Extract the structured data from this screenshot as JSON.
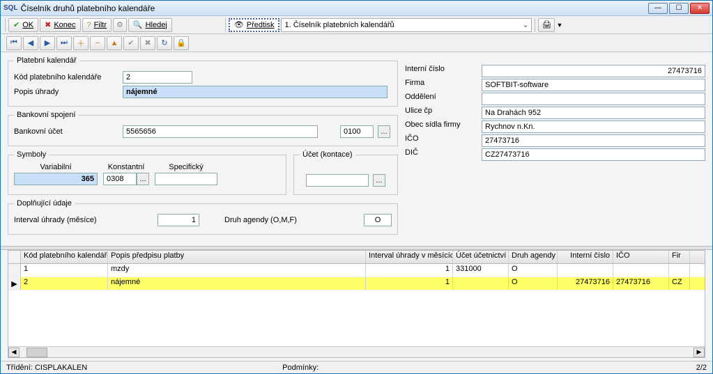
{
  "window": {
    "title": "Číselník druhů platebního kalendáře"
  },
  "toolbar": {
    "ok": "OK",
    "konec": "Konec",
    "filtr": "Filtr",
    "hledej": "Hledej",
    "predtisk": "Předtisk",
    "combo_value": "1. Číselník platebních kalendářů"
  },
  "form": {
    "platebni_kalendar_legend": "Platební kalendář",
    "kod_label": "Kód platebního kalendáře",
    "kod_value": "2",
    "popis_label": "Popis úhrady",
    "popis_value": "nájemné",
    "bankovni_spojeni_legend": "Bankovní spojení",
    "bankovni_ucet_label": "Bankovní účet",
    "bankovni_ucet_value": "5565656",
    "bank_code": "0100",
    "symboly_legend": "Symboly",
    "variabilni_label": "Variabilní",
    "variabilni_value": "365",
    "konstantni_label": "Konstantní",
    "konstantni_value": "0308",
    "specificky_label": "Specifický",
    "specificky_value": "",
    "ucet_kontace_legend": "Účet (kontace)",
    "ucet_kontace_value": "",
    "doplnujici_legend": "Doplňující údaje",
    "interval_label": "Interval úhrady (měsíce)",
    "interval_value": "1",
    "druh_agendy_label": "Druh agendy (O,M,F)",
    "druh_agendy_value": "O"
  },
  "right": {
    "interni_label": "Interní číslo",
    "interni_value": "27473716",
    "firma_label": "Firma",
    "firma_value": "SOFTBIT-software",
    "oddeleni_label": "Oddělení",
    "oddeleni_value": "",
    "ulice_label": "Ulice čp",
    "ulice_value": "Na Drahách 952",
    "obec_label": "Obec sídla firmy",
    "obec_value": "Rychnov n.Kn.",
    "ico_label": "IČO",
    "ico_value": "27473716",
    "dic_label": "DIČ",
    "dic_value": "CZ27473716"
  },
  "grid": {
    "columns": [
      "Kód platebního kalendáře",
      "Popis předpisu platby",
      "Interval úhrady v měsících",
      "Účet účetnictví",
      "Druh agendy",
      "Interní číslo",
      "IČO",
      "Fir"
    ],
    "rows": [
      {
        "kod": "1",
        "popis": "mzdy",
        "interval": "1",
        "ucet": "331000",
        "druh": "O",
        "interni": "",
        "ico": "",
        "fir": ""
      },
      {
        "kod": "2",
        "popis": "nájemné",
        "interval": "1",
        "ucet": "",
        "druh": "O",
        "interni": "27473716",
        "ico": "27473716",
        "fir": "CZ"
      }
    ]
  },
  "status": {
    "trideni": "Třídění: CISPLAKALEN",
    "podminky": "Podmínky:",
    "counter": "2/2"
  }
}
